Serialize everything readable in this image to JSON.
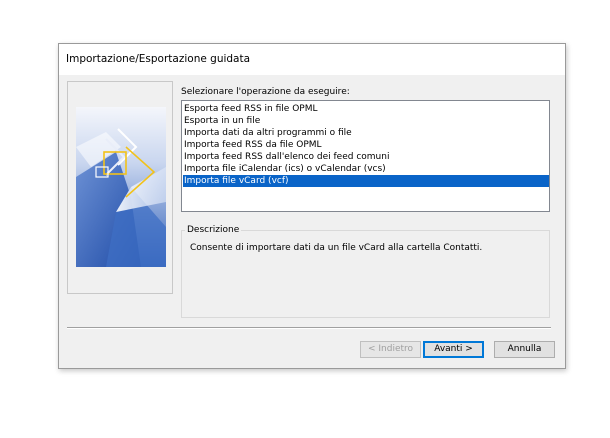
{
  "window": {
    "title": "Importazione/Esportazione guidata"
  },
  "main": {
    "instruction": "Selezionare l'operazione da eseguire:",
    "actions": [
      {
        "label": "Esporta feed RSS in file OPML",
        "selected": false
      },
      {
        "label": "Esporta in un file",
        "selected": false
      },
      {
        "label": "Importa dati da altri programmi o file",
        "selected": false
      },
      {
        "label": "Importa feed RSS da file OPML",
        "selected": false
      },
      {
        "label": "Importa feed RSS dall'elenco dei feed comuni",
        "selected": false
      },
      {
        "label": "Importa file iCalendar (ics) o vCalendar (vcs)",
        "selected": false
      },
      {
        "label": "Importa file vCard (vcf)",
        "selected": true
      }
    ],
    "description": {
      "legend": "Descrizione",
      "text": "Consente di importare dati da un file vCard alla cartella Contatti."
    }
  },
  "buttons": {
    "back": "< Indietro",
    "next": "Avanti >",
    "cancel": "Annulla"
  },
  "colors": {
    "selection": "#0a64c8",
    "default_button_border": "#0078d7",
    "dialog_background": "#f0f0f0"
  },
  "icons": {
    "wizard_art": "wizard-arrows-icon"
  }
}
